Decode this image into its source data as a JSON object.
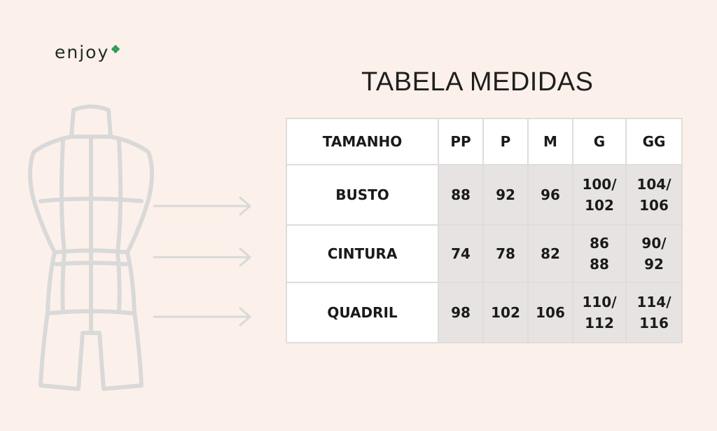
{
  "brand": {
    "name": "enjoy",
    "dot_color": "#2e9a55"
  },
  "title": "TABELA MEDIDAS",
  "table": {
    "header": [
      "TAMANHO",
      "PP",
      "P",
      "M",
      "G",
      "GG"
    ],
    "rows": [
      {
        "label": "BUSTO",
        "pp": "88",
        "p": "92",
        "m": "96",
        "g": [
          "100/",
          "102"
        ],
        "gg": [
          "104/",
          "106"
        ]
      },
      {
        "label": "CINTURA",
        "pp": "74",
        "p": "78",
        "m": "82",
        "g": [
          "86",
          "88"
        ],
        "gg": [
          "90/",
          "92"
        ]
      },
      {
        "label": "QUADRIL",
        "pp": "98",
        "p": "102",
        "m": "106",
        "g": [
          "110/",
          "112"
        ],
        "gg": [
          "114/",
          "116"
        ]
      }
    ]
  },
  "colors": {
    "background": "#fcf1ea",
    "cell_shade": "#e6e3e2",
    "grid": "#e0dcdc",
    "mannequin": "#d9d9d9"
  }
}
